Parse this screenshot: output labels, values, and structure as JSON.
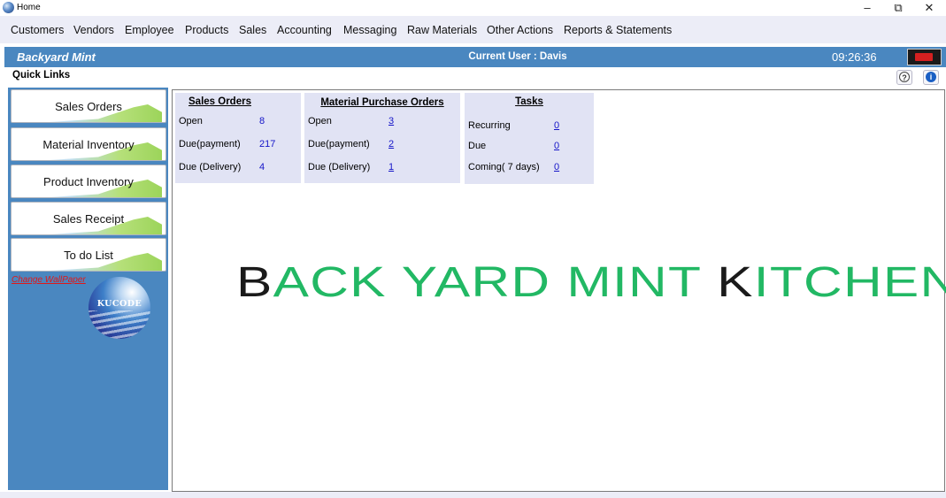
{
  "window": {
    "title": "Home",
    "minimize_glyph": "–",
    "maximize_glyph": "⧉",
    "close_glyph": "✕"
  },
  "menu": [
    "Customers",
    "Vendors",
    "Employee",
    "Products",
    "Sales",
    "Accounting",
    "Messaging",
    "Raw Materials",
    "Other Actions",
    "Reports & Statements"
  ],
  "header": {
    "brand": "Backyard Mint",
    "current_user": "Current User : Davis",
    "time": "09:26:36",
    "exit_icon": "exit-door-icon"
  },
  "quick_links": {
    "title": "Quick Links",
    "help_glyph": "?",
    "info_glyph": "i",
    "buttons": [
      "Sales Orders",
      "Material Inventory",
      "Product Inventory",
      "Sales Receipt",
      "To do List"
    ],
    "change_wallpaper": "Change WallPaper",
    "logo_text": "KUCODE"
  },
  "cards": {
    "sales_orders": {
      "title": "Sales Orders",
      "rows": [
        {
          "label": "Open",
          "value": "8"
        },
        {
          "label": "Due(payment)",
          "value": "217"
        },
        {
          "label": "Due (Delivery)",
          "value": "4"
        }
      ]
    },
    "material_purchase_orders": {
      "title": "Material Purchase Orders",
      "rows": [
        {
          "label": "Open",
          "value": "3"
        },
        {
          "label": "Due(payment)",
          "value": "2"
        },
        {
          "label": "Due (Delivery)",
          "value": "1"
        }
      ]
    },
    "tasks": {
      "title": "Tasks",
      "rows": [
        {
          "label": "Recurring",
          "value": "0"
        },
        {
          "label": "Due",
          "value": "0"
        },
        {
          "label": "Coming( 7 days)",
          "value": "0"
        }
      ]
    }
  },
  "banner": {
    "parts": [
      {
        "text": "B",
        "color": "dark"
      },
      {
        "text": "ACK YARD MINT ",
        "color": "green"
      },
      {
        "text": "K",
        "color": "dark"
      },
      {
        "text": "ITCHEN",
        "color": "green"
      }
    ]
  },
  "colors": {
    "header_blue": "#4a87c0",
    "menu_bg": "#ecedf7",
    "card_bg": "#e1e3f4",
    "link_blue": "#1515c8",
    "banner_green": "#22b864",
    "banner_dark": "#1a1a1a",
    "wallpaper_link_red": "#e01818"
  }
}
